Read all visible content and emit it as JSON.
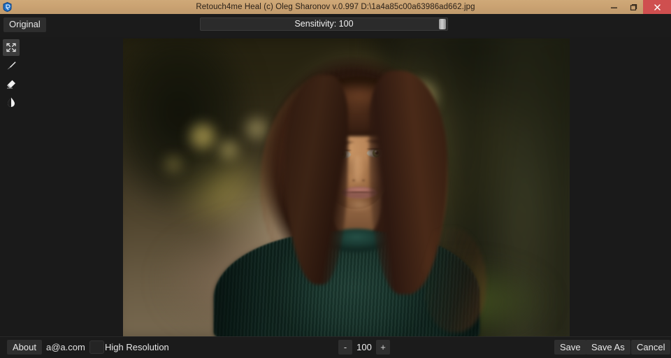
{
  "window": {
    "title": "Retouch4me Heal (c) Oleg Sharonov v.0.997 D:\\1a4a85c00a63986ad662.jpg",
    "app_icon": "retouch4me-app-icon",
    "controls": {
      "minimize": "minimize-icon",
      "maximize": "maximize-icon",
      "close": "close-icon"
    },
    "titlebar_color": "#c9a171",
    "close_button_color": "#cf4f4f"
  },
  "toolbar": {
    "original_label": "Original",
    "sensitivity_label": "Sensitivity: 100",
    "sensitivity_value": 100,
    "sensitivity_min": 0,
    "sensitivity_max": 100
  },
  "tools": [
    {
      "name": "fit-to-screen-tool",
      "icon": "fit-screen-icon",
      "active": true
    },
    {
      "name": "brush-tool",
      "icon": "brush-icon",
      "active": false
    },
    {
      "name": "eraser-tool",
      "icon": "eraser-icon",
      "active": false
    },
    {
      "name": "contrast-tool",
      "icon": "contrast-droplet-icon",
      "active": false
    }
  ],
  "canvas": {
    "image_description": "Portrait photograph of a woman with long dark brown hair wearing a dark green ribbed turtleneck sweater, standing on a blurred autumn park path with golden bokeh",
    "accent_sweater_color": "#16302a",
    "accent_bokeh_color": "#e8c44f"
  },
  "bottom": {
    "about_label": "About",
    "email": "a@a.com",
    "high_resolution_label": "High Resolution",
    "high_resolution_checked": false,
    "zoom_minus": "-",
    "zoom_value": "100",
    "zoom_plus": "+",
    "save_label": "Save",
    "save_as_label": "Save As",
    "cancel_label": "Cancel"
  }
}
